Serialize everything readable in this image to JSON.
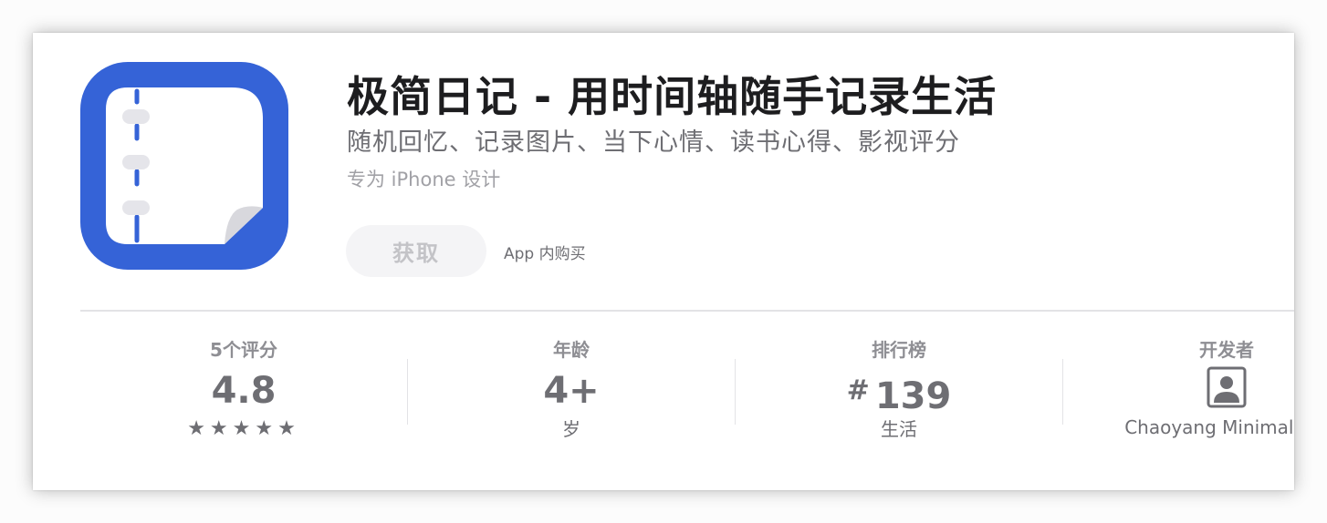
{
  "app": {
    "title": "极简日记 - 用时间轴随手记录生活",
    "subtitle": "随机回忆、记录图片、当下心情、读书心得、影视评分",
    "designed_for": "专为 iPhone 设计",
    "get_label": "获取",
    "in_app_purchase": "App 内购买"
  },
  "stats": {
    "ratings": {
      "label": "5个评分",
      "value": "4.8",
      "stars": "★★★★★",
      "star_count": 5
    },
    "age": {
      "label": "年龄",
      "value": "4+",
      "sub": "岁"
    },
    "chart": {
      "label": "排行榜",
      "hash": "#",
      "value": "139",
      "sub": "生活"
    },
    "developer": {
      "label": "开发者",
      "icon": "person-square-icon",
      "name": "Chaoyang Minimal Sof"
    }
  },
  "colors": {
    "icon_blue": "#3563D7",
    "text_primary": "#1d1d1f",
    "text_secondary": "#6e6e73",
    "text_tertiary": "#a1a1a6"
  }
}
